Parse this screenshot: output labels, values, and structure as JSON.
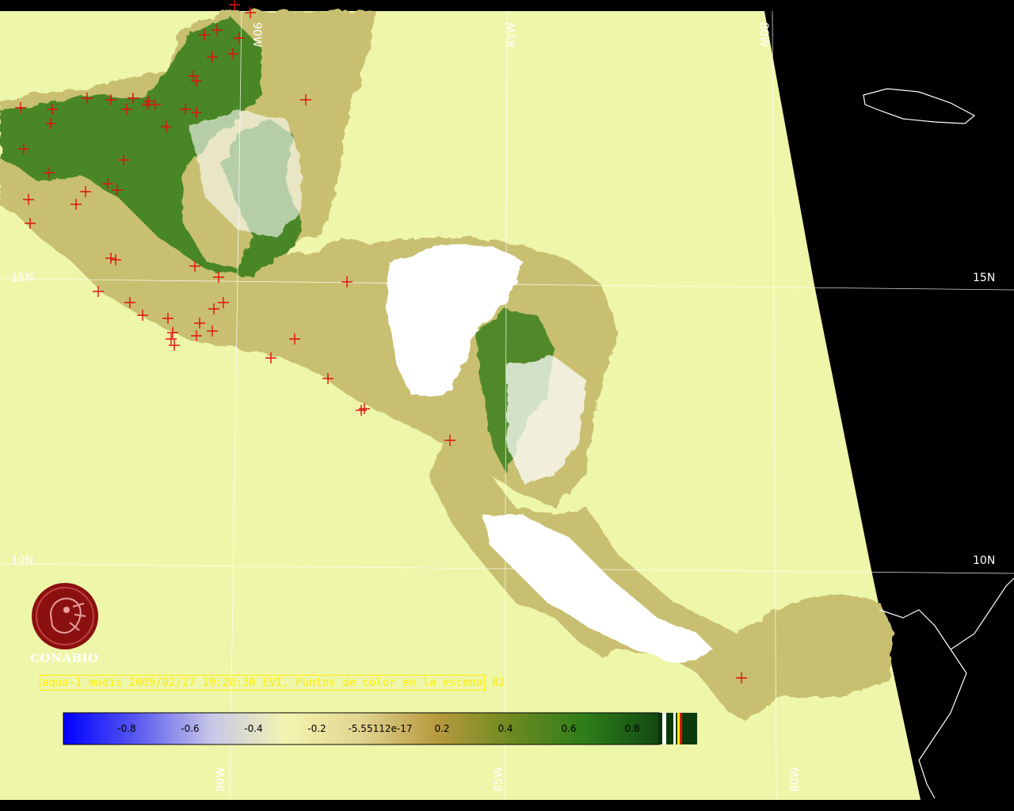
{
  "map": {
    "background_color": "#000000",
    "scene_color": "#eef6aa",
    "cloud_color": "#ffffff",
    "vegetation_color": "#2e7d1a",
    "fire_marker_color": "#e01010",
    "coastline_color": "#ffffff",
    "gridlines": {
      "longitude_labels_top": [
        "90W",
        "85W",
        "80W"
      ],
      "longitude_labels_bottom": [
        "90W",
        "85W",
        "80W"
      ],
      "latitude_labels_left": [
        "15N",
        "10N"
      ],
      "latitude_labels_right": [
        "15N",
        "10N"
      ]
    }
  },
  "logo": {
    "icon": "conabio-logo-icon",
    "text": "CONABIO",
    "color": "#8b1010"
  },
  "caption": {
    "text": "aqua-1 modis 2009/02/27 19:28:30 EVI, Puntos de color en la escena",
    "count": "82",
    "color": "#ffee00"
  },
  "colorbar": {
    "ticks": [
      "-0.8",
      "-0.6",
      "-0.4",
      "-0.2",
      "-5.55112e-17",
      "0.2",
      "0.4",
      "0.6",
      "0.8"
    ],
    "stops": [
      "#0000ff",
      "#5a5af0",
      "#c8c8e8",
      "#f4f4b0",
      "#e0d490",
      "#b89a40",
      "#6e8a20",
      "#2e7d1a",
      "#124a12"
    ]
  }
}
